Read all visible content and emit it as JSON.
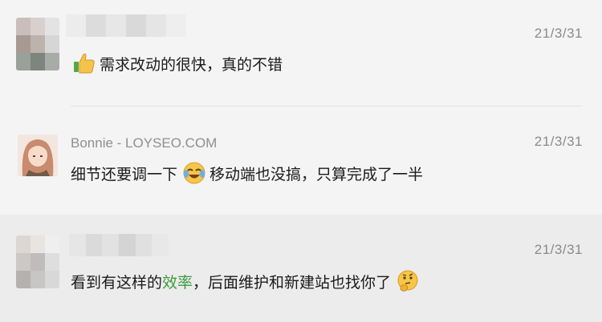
{
  "comments": [
    {
      "name": "",
      "time": "21/3/31",
      "emoji": "thumbs-up-icon",
      "text": "需求改动的很快，真的不错"
    },
    {
      "name": "Bonnie - LOYSEO.COM",
      "time": "21/3/31",
      "text_before": "细节还要调一下",
      "emoji": "laughing-crying-icon",
      "text_after": "移动端也没搞，只算完成了一半"
    },
    {
      "name": "",
      "time": "21/3/31",
      "text_before": "看到有这样的",
      "text_highlight": "效率",
      "text_after": "，后面维护和新建站也找你了",
      "emoji": "thinking-face-icon"
    }
  ],
  "colors": {
    "highlight": "#3c9a3c",
    "name": "#8f8f8f",
    "time": "#8a8a8a"
  }
}
